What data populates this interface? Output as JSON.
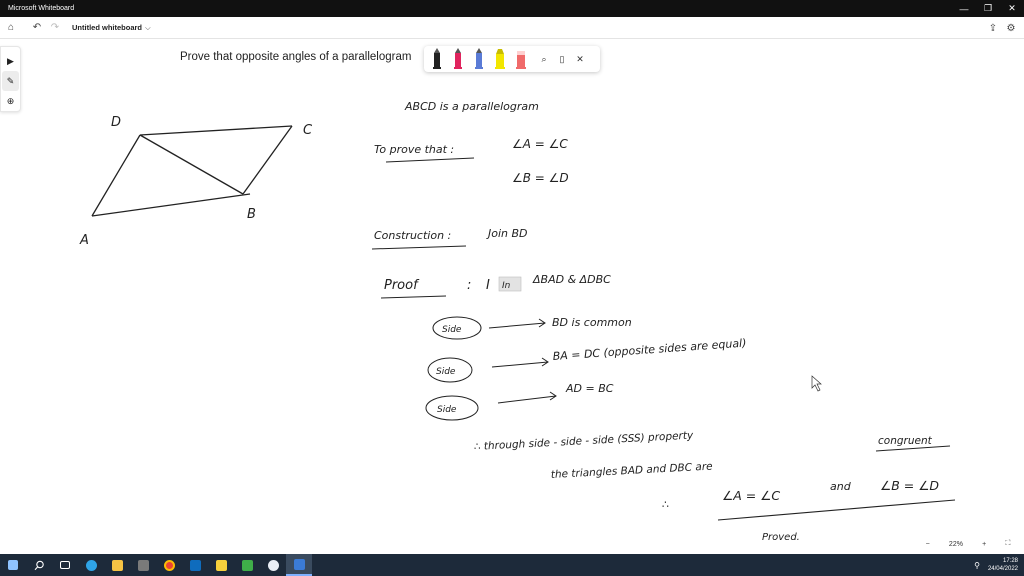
{
  "window": {
    "app_title": "Microsoft Whiteboard"
  },
  "toolbar": {
    "doc_title": "Untitled whiteboard",
    "chevron": "⌵"
  },
  "note": {
    "title": "Prove that opposite angles of a parallelogram"
  },
  "figure": {
    "label_a": "A",
    "label_b": "B",
    "label_c": "C",
    "label_d": "D"
  },
  "ink": {
    "line1": "ABCD is a parallelogram",
    "to_prove": "To prove that :",
    "eq1": "∠A = ∠C",
    "eq2": "∠B = ∠D",
    "construction": "Construction :",
    "join": "Join BD",
    "proof": "Proof",
    "colon": ":",
    "in": "In",
    "in_triangles": "ΔBAD & ΔDBC",
    "side_label": "Side",
    "side1_text": "BD is common",
    "side2_text": "BA = DC (opposite sides are equal)",
    "side3_text": "AD = BC",
    "therefore1": "∴ through side - side - side (SSS) property",
    "therefore1b": "the triangles BAD and DBC are",
    "congruent": "congruent",
    "therefore2": "∴",
    "conclusion_a": "∠A = ∠C",
    "and": "and",
    "conclusion_b": "∠B = ∠D",
    "proved": "Proved."
  },
  "zoom": {
    "minus": "−",
    "level": "22%",
    "plus": "+",
    "fit": "⛶"
  },
  "clock": {
    "time": "17:28",
    "date": "24/04/2022"
  },
  "colors": {
    "taskbar": "#1d2a3a",
    "titlebar": "#111111",
    "pen_black": "#222222",
    "pen_pink": "#e0245e",
    "pen_blue": "#5a7bd6",
    "pen_yellow": "#f2e600",
    "pen_red": "#f06a6a"
  }
}
